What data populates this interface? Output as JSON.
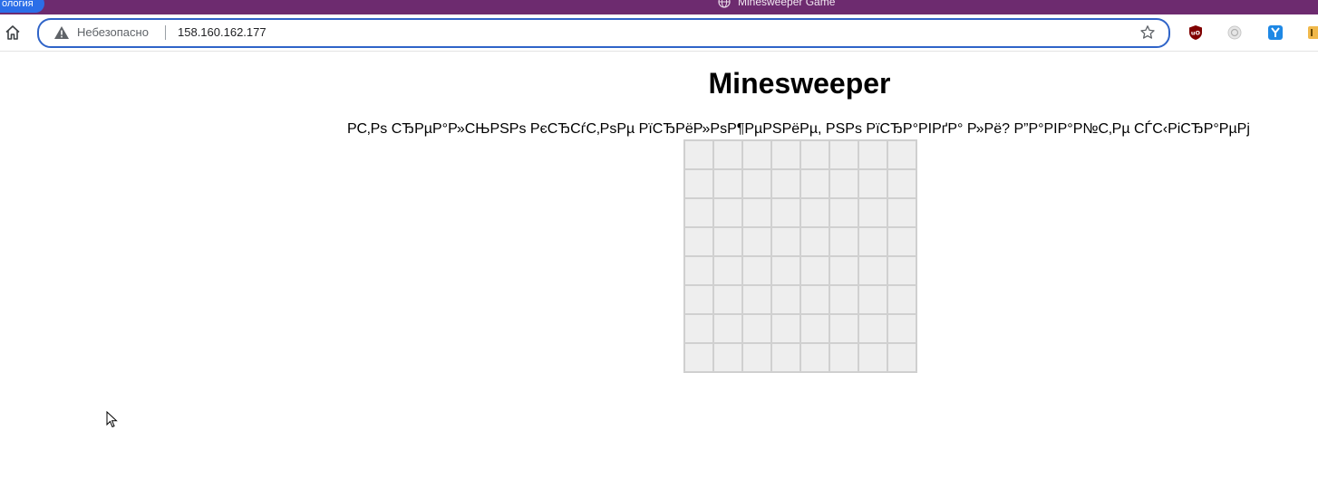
{
  "browser": {
    "profile_label": "ология",
    "tab_title": "Minesweeper Game",
    "security_label": "Небезопасно",
    "url": "158.160.162.177",
    "colors": {
      "titlebar": "#6d2b6f",
      "omnibox_border": "#2f64c8"
    },
    "extensions": [
      {
        "name": "ublock-icon"
      },
      {
        "name": "extension-gray-icon"
      },
      {
        "name": "yandex-icon"
      },
      {
        "name": "extension-partial-icon"
      }
    ]
  },
  "page": {
    "title": "Minesweeper",
    "prompt": "РС‚Рѕ СЂРµР°Р»СЊРЅРѕ РєСЂСѓС‚РѕРµ РїСЂРёР»РѕР¶РµРЅРёРµ, РЅРѕ РїСЂР°РІРґР° Р»Рё? Р”Р°РІР°Р№С‚Рµ СЃС‹РіСЂР°РµРј"
  },
  "board": {
    "rows": 8,
    "cols": 8,
    "cell_color": "#eeeeee"
  }
}
